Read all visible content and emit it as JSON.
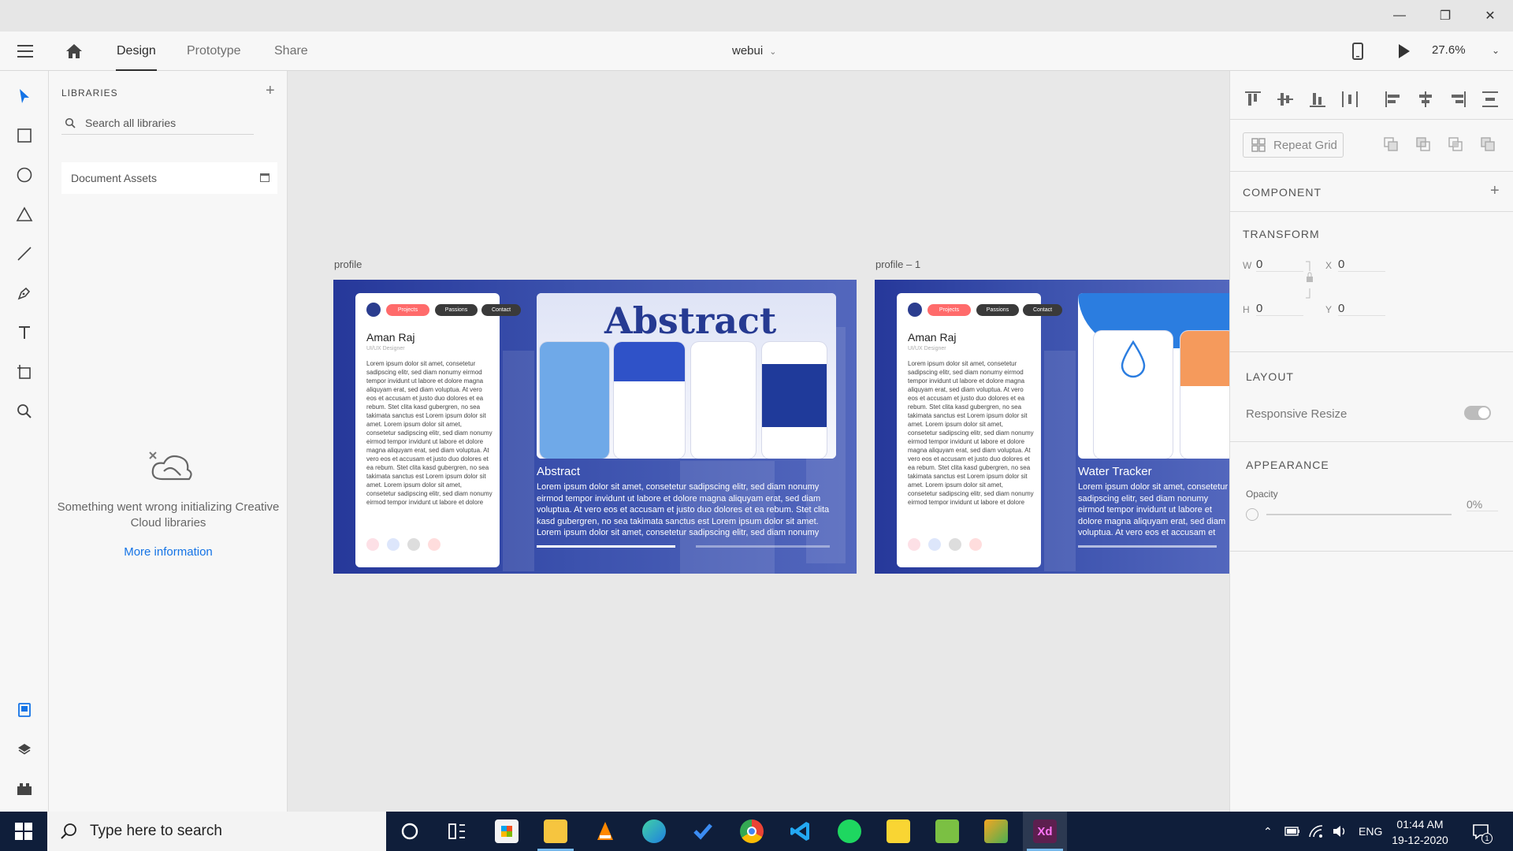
{
  "window": {
    "minimize": "—",
    "maximize": "❐",
    "close": "✕"
  },
  "topbar": {
    "tabs": [
      {
        "label": "Design",
        "active": true
      },
      {
        "label": "Prototype",
        "active": false
      },
      {
        "label": "Share",
        "active": false
      }
    ],
    "document_name": "webui",
    "zoom": "27.6%"
  },
  "tools": [
    "select-tool",
    "rectangle-tool",
    "ellipse-tool",
    "polygon-tool",
    "line-tool",
    "pen-tool",
    "text-tool",
    "artboard-tool",
    "zoom-tool",
    "assets-tool",
    "layers-tool",
    "plugins-tool"
  ],
  "libraries": {
    "title": "LIBRARIES",
    "search_placeholder": "Search all libraries",
    "document_assets": "Document Assets",
    "error": "Something went wrong initializing Creative Cloud libraries",
    "more_info": "More information"
  },
  "artboards": [
    {
      "label": "profile",
      "card_name": "Aman Raj",
      "card_role": "UI/UX Designer",
      "tabs": [
        "Projects",
        "Passions",
        "Contact"
      ],
      "card_text": "Lorem ipsum dolor sit amet, consetetur sadipscing elitr, sed diam nonumy eirmod tempor invidunt ut labore et dolore magna aliquyam erat, sed diam voluptua. At vero eos et accusam et justo duo dolores et ea rebum. Stet clita kasd gubergren, no sea takimata sanctus est Lorem ipsum dolor sit amet. Lorem ipsum dolor sit amet, consetetur sadipscing elitr, sed diam nonumy eirmod tempor invidunt ut labore et dolore magna aliquyam erat, sed diam voluptua. At vero eos et accusam et justo duo dolores et ea rebum. Stet clita kasd gubergren, no sea takimata sanctus est Lorem ipsum dolor sit amet. Lorem ipsum dolor sit amet, consetetur sadipscing elitr, sed diam nonumy eirmod tempor invidunt ut labore et dolore",
      "showcase_word": "Abstract",
      "project_title": "Abstract",
      "project_text": "Lorem ipsum dolor sit amet, consetetur sadipscing elitr, sed diam nonumy eirmod tempor invidunt ut labore et dolore magna aliquyam erat, sed diam voluptua. At vero eos et accusam et justo duo dolores et ea rebum. Stet clita kasd gubergren, no sea takimata sanctus est Lorem ipsum dolor sit amet. Lorem ipsum dolor sit amet, consetetur sadipscing elitr, sed diam nonumy"
    },
    {
      "label": "profile – 1",
      "card_name": "Aman Raj",
      "card_role": "UI/UX Designer",
      "tabs": [
        "Projects",
        "Passions",
        "Contact"
      ],
      "card_text": "Lorem ipsum dolor sit amet, consetetur sadipscing elitr, sed diam nonumy eirmod tempor invidunt ut labore et dolore magna aliquyam erat, sed diam voluptua. At vero eos et accusam et justo duo dolores et ea rebum. Stet clita kasd gubergren, no sea takimata sanctus est Lorem ipsum dolor sit amet. Lorem ipsum dolor sit amet, consetetur sadipscing elitr, sed diam nonumy eirmod tempor invidunt ut labore et dolore magna aliquyam erat, sed diam voluptua. At vero eos et accusam et justo duo dolores et ea rebum. Stet clita kasd gubergren, no sea takimata sanctus est Lorem ipsum dolor sit amet. Lorem ipsum dolor sit amet, consetetur sadipscing elitr, sed diam nonumy eirmod tempor invidunt ut labore et dolore",
      "project_title": "Water Tracker",
      "project_text": "Lorem ipsum dolor sit amet, consetetur sadipscing elitr, sed diam nonumy eirmod tempor invidunt ut labore et dolore magna aliquyam erat, sed diam voluptua. At vero eos et accusam et justo duo dolores et ea rebum. Stet clita kasd gubergren, no sea takimata sanctus est Lorem ipsum dolor sit amet. Lorem ipsum dolor sit amet, consetetur"
    }
  ],
  "properties": {
    "repeat_grid": "Repeat Grid",
    "component": "COMPONENT",
    "transform": "TRANSFORM",
    "w_label": "W",
    "w_value": "0",
    "h_label": "H",
    "h_value": "0",
    "x_label": "X",
    "x_value": "0",
    "y_label": "Y",
    "y_value": "0",
    "layout": "LAYOUT",
    "responsive_resize": "Responsive Resize",
    "appearance": "APPEARANCE",
    "opacity_label": "Opacity",
    "opacity_value": "0%"
  },
  "taskbar": {
    "search_placeholder": "Type here to search",
    "language": "ENG",
    "time": "01:44 AM",
    "date": "19-12-2020",
    "notifications": "1"
  },
  "colors": {
    "accent": "#1473e6",
    "artboard_blue": "#2a3f9a",
    "taskbar": "#0f1e3a",
    "pill_red": "#ff6b6b"
  }
}
